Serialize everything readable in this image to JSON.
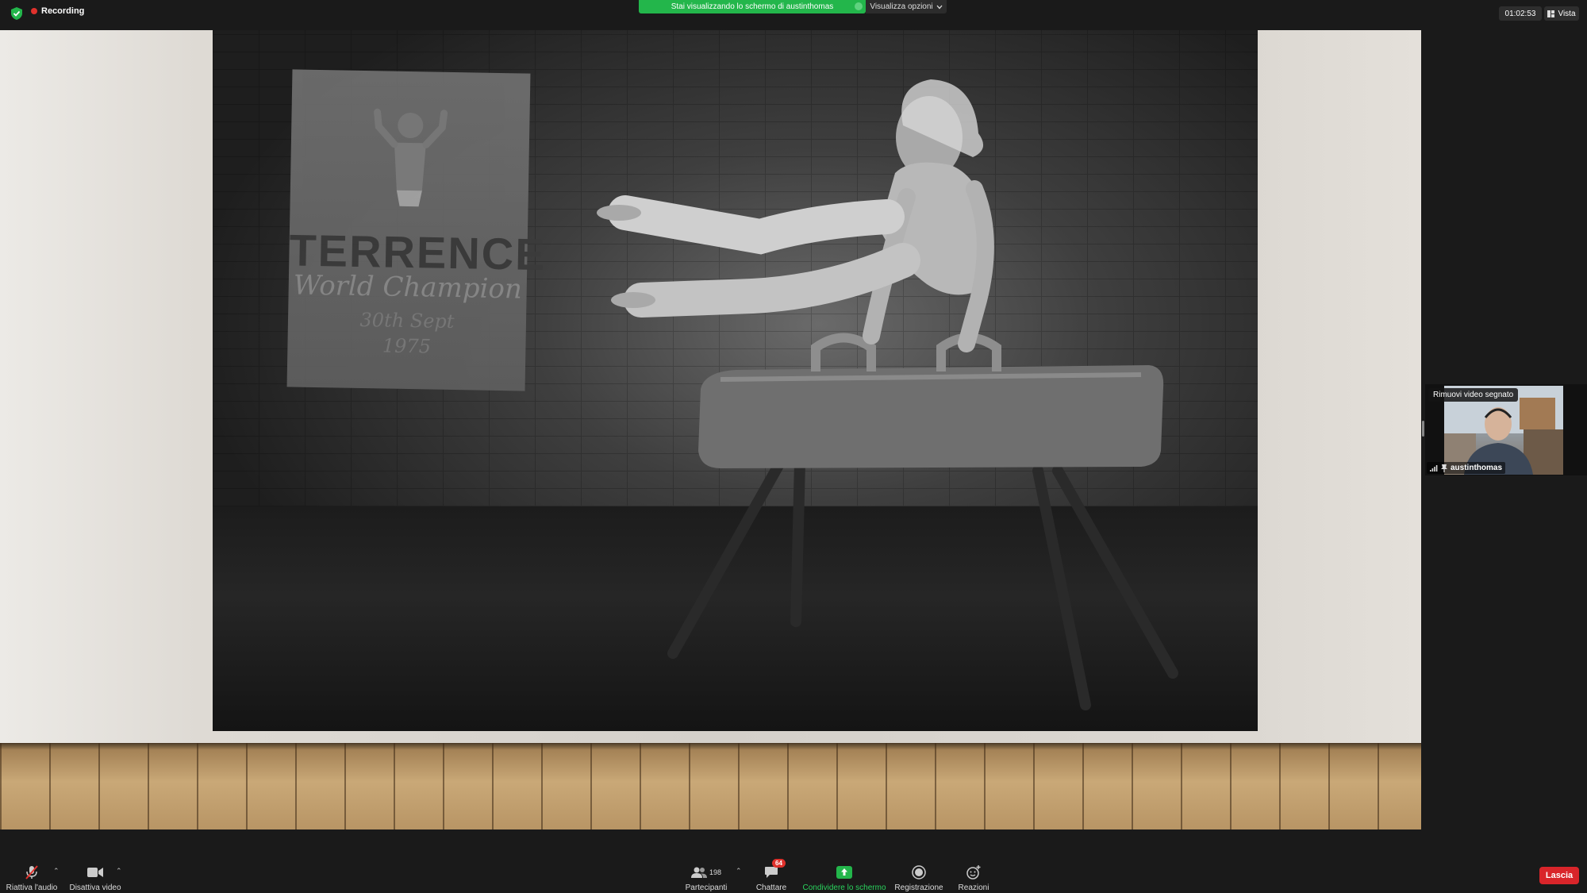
{
  "topbar": {
    "recording_label": "Recording",
    "share_banner_text": "Stai visualizzando lo schermo di austinthomas",
    "view_options_label": "Visualizza opzioni",
    "clock": "01:02:53",
    "view_label": "Vista"
  },
  "shared_content": {
    "poster": {
      "name": "TERRENCE",
      "subtitle": "World Champion",
      "date": "30th Sept",
      "year": "1975"
    }
  },
  "participant_tile": {
    "overlay_label": "Rimuovi video segnato",
    "name": "austinthomas"
  },
  "toolbar": {
    "audio_label": "Riattiva l'audio",
    "video_label": "Disattiva video",
    "participants_label": "Partecipanti",
    "participants_count": "198",
    "chat_label": "Chattare",
    "chat_badge": "64",
    "share_label": "Condividere lo schermo",
    "record_label": "Registrazione",
    "reactions_label": "Reazioni",
    "leave_label": "Lascia"
  },
  "colors": {
    "share_green": "#23b64b",
    "leave_red": "#d9252a",
    "recording_red": "#e0312c"
  },
  "icons": [
    "shield-check-icon",
    "microphone-muted-icon",
    "video-camera-icon",
    "participants-icon",
    "chat-icon",
    "share-screen-icon",
    "record-icon",
    "reactions-icon",
    "signal-icon",
    "pin-icon",
    "chevron-down-icon",
    "chevron-up-icon",
    "view-icon"
  ]
}
